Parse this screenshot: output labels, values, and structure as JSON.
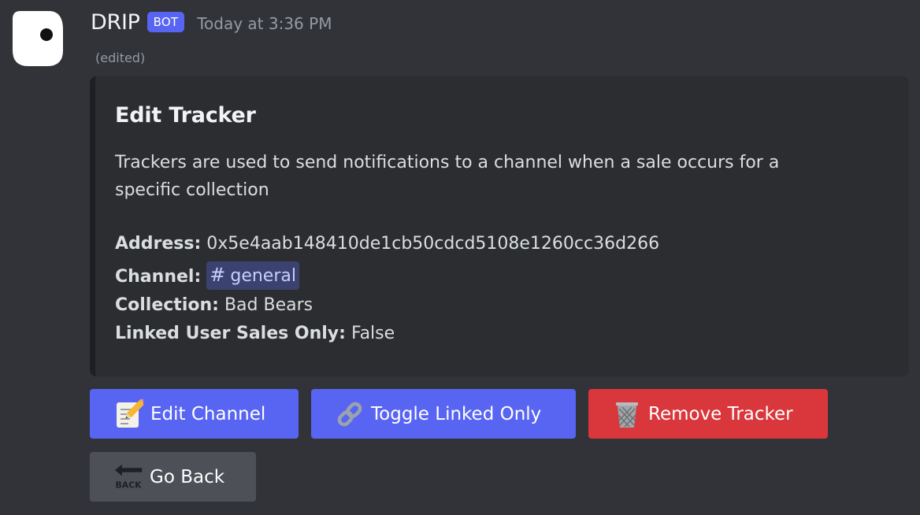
{
  "message": {
    "username": "DRIP",
    "bot_tag": "BOT",
    "timestamp": "Today at 3:36 PM",
    "edited": "(edited)"
  },
  "embed": {
    "title": "Edit Tracker",
    "description": "Trackers are used to send notifications to a channel when a sale occurs for a specific collection",
    "fields": {
      "address": {
        "label": "Address:",
        "value": "0x5e4aab148410de1cb50cdcd5108e1260cc36d266"
      },
      "channel": {
        "label": "Channel:",
        "hash": "#",
        "value": "general"
      },
      "collection": {
        "label": "Collection:",
        "value": "Bad Bears"
      },
      "linked_user_sales_only": {
        "label": "Linked User Sales Only:",
        "value": "False"
      }
    }
  },
  "buttons": {
    "edit_channel": {
      "label": "Edit Channel",
      "icon": "memo-icon"
    },
    "toggle_linked_only": {
      "label": "Toggle Linked Only",
      "icon": "link-icon"
    },
    "remove_tracker": {
      "label": "Remove Tracker",
      "icon": "wastebasket-icon"
    },
    "go_back": {
      "label": "Go Back",
      "icon": "back-arrow-icon",
      "icon_text": "BACK"
    }
  },
  "colors": {
    "background": "#313338",
    "embed_background": "#2b2d31",
    "primary_button": "#5865f2",
    "danger_button": "#da373c",
    "secondary_button": "#4e5058",
    "mention_background": "#3c4270",
    "bot_tag": "#5865f2"
  }
}
